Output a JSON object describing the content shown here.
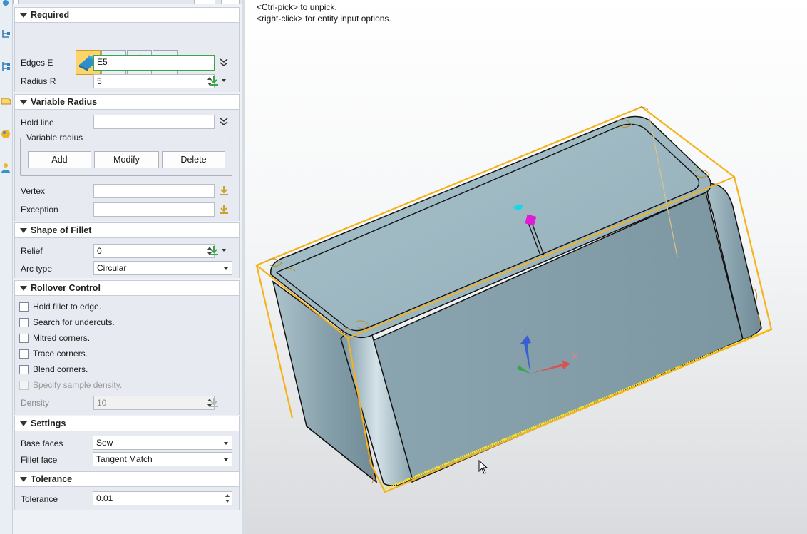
{
  "hints": {
    "line1": "<Ctrl-pick> to unpick.",
    "line2": "<right-click> for entity input options."
  },
  "required": {
    "title": "Required",
    "edges_label": "Edges E",
    "edges_value": "E5",
    "radius_label": "Radius R",
    "radius_value": "5"
  },
  "variable_radius": {
    "title": "Variable Radius",
    "hold_line_label": "Hold line",
    "hold_line_value": "",
    "group_title": "Variable radius",
    "add_label": "Add",
    "modify_label": "Modify",
    "delete_label": "Delete",
    "vertex_label": "Vertex",
    "vertex_value": "",
    "exception_label": "Exception",
    "exception_value": ""
  },
  "shape_of_fillet": {
    "title": "Shape of Fillet",
    "relief_label": "Relief",
    "relief_value": "0",
    "arc_type_label": "Arc type",
    "arc_type_value": "Circular"
  },
  "rollover": {
    "title": "Rollover Control",
    "options": [
      {
        "label": "Hold fillet to edge.",
        "checked": false,
        "enabled": true
      },
      {
        "label": "Search for undercuts.",
        "checked": false,
        "enabled": true
      },
      {
        "label": "Mitred corners.",
        "checked": false,
        "enabled": true
      },
      {
        "label": "Trace corners.",
        "checked": false,
        "enabled": true
      },
      {
        "label": "Blend corners.",
        "checked": false,
        "enabled": true
      },
      {
        "label": "Specify sample density.",
        "checked": false,
        "enabled": false
      }
    ],
    "density_label": "Density",
    "density_value": "10"
  },
  "settings": {
    "title": "Settings",
    "base_faces_label": "Base faces",
    "base_faces_value": "Sew",
    "fillet_face_label": "Fillet face",
    "fillet_face_value": "Tangent Match"
  },
  "tolerance": {
    "title": "Tolerance",
    "tolerance_label": "Tolerance",
    "tolerance_value": "0.01"
  },
  "triad": {
    "z": "Z",
    "x": "X"
  },
  "colors": {
    "selection": "#f5b21b",
    "model_face": "#9fb9c3",
    "active_field": "#3aa54a",
    "type_selected": "#fcd46c"
  }
}
